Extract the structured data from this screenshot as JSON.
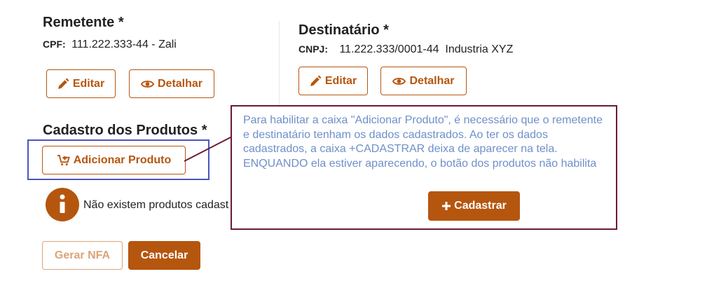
{
  "sender": {
    "title": "Remetente *",
    "doc_label": "CPF:",
    "doc_value": "111.222.333-44 - Zali",
    "edit_label": "Editar",
    "details_label": "Detalhar"
  },
  "recipient": {
    "title": "Destinatário *",
    "doc_label": "CNPJ:",
    "doc_value": "11.222.333/0001-44  Industria XYZ",
    "edit_label": "Editar",
    "details_label": "Detalhar"
  },
  "products": {
    "title": "Cadastro dos Produtos *",
    "add_label": "Adicionar Produto",
    "empty_message": "Não existem produtos cadast"
  },
  "actions": {
    "generate_label": "Gerar NFA",
    "cancel_label": "Cancelar"
  },
  "callout": {
    "text": "Para habilitar a caixa \"Adicionar Produto\", é necessário que o remetente e destinatário tenham os dados cadastrados. Ao ter os dados cadastrados, a caixa +CADASTRAR deixa de aparecer na tela. ENQUANDO ela estiver aparecendo, o botão dos produtos não habilita",
    "register_label": "Cadastrar"
  },
  "colors": {
    "accent": "#b5560f",
    "highlight_border": "#4a57b8",
    "callout_border": "#6e1a35",
    "callout_text": "#6f8fc9"
  },
  "icons": {
    "edit": "pencil-icon",
    "details": "eye-icon",
    "add_product": "cart-plus-icon",
    "info": "info-icon",
    "register": "plus-icon"
  }
}
